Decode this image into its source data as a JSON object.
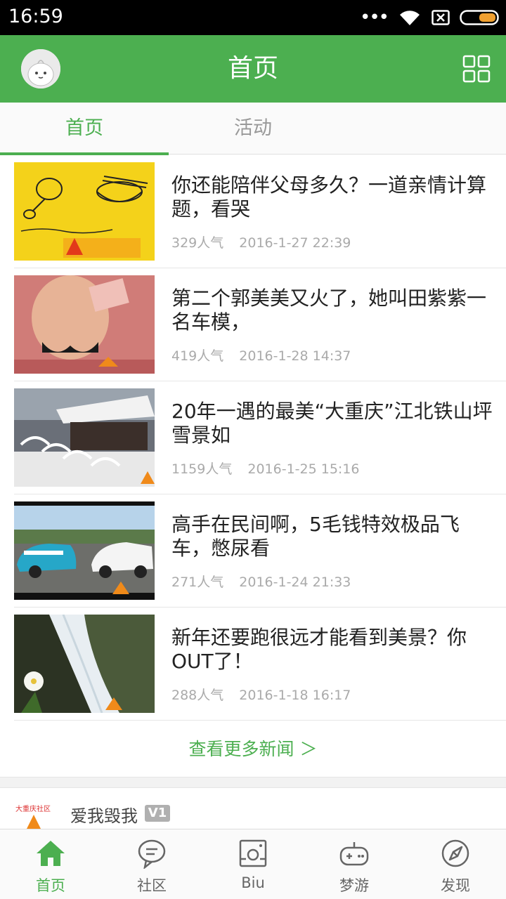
{
  "status_bar": {
    "time": "16:59",
    "icons": [
      "more-dots-icon",
      "wifi-icon",
      "sim-disabled-icon",
      "battery-icon"
    ],
    "battery_color": "#f0a030"
  },
  "header": {
    "title": "首页",
    "accent_color": "#4caf50",
    "left_icon": "avatar",
    "right_icon": "grid-menu-icon"
  },
  "tabs": [
    {
      "label": "首页",
      "active": true
    },
    {
      "label": "活动",
      "active": false
    }
  ],
  "news": [
    {
      "title": "你还能陪伴父母多久？一道亲情计算题，看哭",
      "views": "329人气",
      "date": "2016-1-27 22:39"
    },
    {
      "title": "第二个郭美美又火了，她叫田紫紫一名车模，",
      "views": "419人气",
      "date": "2016-1-28 14:37"
    },
    {
      "title": "20年一遇的最美“大重庆”江北铁山坪雪景如",
      "views": "1159人气",
      "date": "2016-1-25 15:16"
    },
    {
      "title": "高手在民间啊，5毛钱特效极品飞车，憋尿看",
      "views": "271人气",
      "date": "2016-1-24 21:33"
    },
    {
      "title": "新年还要跑很远才能看到美景？你OUT了！",
      "views": "288人气",
      "date": "2016-1-18 16:17"
    }
  ],
  "more_news": "查看更多新闻 ＞",
  "community": {
    "logo_text": "大重庆社区",
    "username": "爱我毁我",
    "badge": "V1"
  },
  "bottom_nav": [
    {
      "label": "首页",
      "icon": "home-icon",
      "active": true
    },
    {
      "label": "社区",
      "icon": "chat-bubble-icon",
      "active": false
    },
    {
      "label": "Biu",
      "icon": "biu-device-icon",
      "active": false
    },
    {
      "label": "梦游",
      "icon": "gamepad-icon",
      "active": false
    },
    {
      "label": "发现",
      "icon": "compass-icon",
      "active": false
    }
  ]
}
